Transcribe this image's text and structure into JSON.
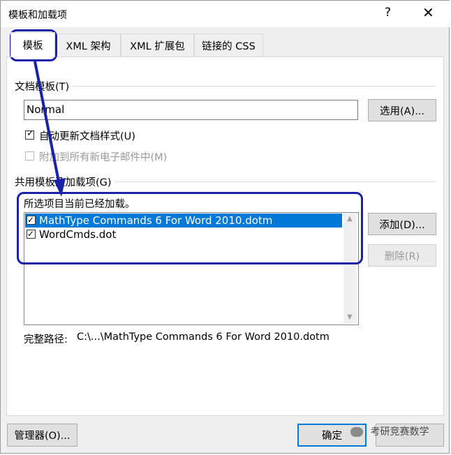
{
  "window": {
    "title": "模板和加载项",
    "help": "?",
    "close": "✕"
  },
  "tabs": [
    {
      "label": "模板",
      "active": true
    },
    {
      "label": "XML 架构"
    },
    {
      "label": "XML 扩展包"
    },
    {
      "label": "链接的 CSS"
    }
  ],
  "document_template": {
    "group_label": "文档模板(T)",
    "value": "Normal",
    "select_button": "选用(A)...",
    "auto_update": {
      "label": "自动更新文档样式(U)",
      "checked": true
    },
    "attach_email": {
      "label": "附加到所有新电子邮件中(M)",
      "checked": false,
      "disabled": true
    }
  },
  "global_templates": {
    "group_label": "共用模板及加载项(G)",
    "hint": "所选项目当前已经加载。",
    "items": [
      {
        "label": "MathType Commands 6 For Word 2010.dotm",
        "checked": true,
        "selected": true
      },
      {
        "label": "WordCmds.dot",
        "checked": true,
        "selected": false
      }
    ],
    "add_button": "添加(D)...",
    "remove_button": "删除(R)",
    "fullpath_label": "完整路径:",
    "fullpath_value": "C:\\...\\MathType Commands 6 For Word 2010.dotm"
  },
  "footer": {
    "organizer_button": "管理器(O)...",
    "ok_button": "确定",
    "cancel_button": "取消"
  },
  "watermark": "考研竞赛数学",
  "colors": {
    "accent": "#0078d7",
    "annotation": "#1a22a8"
  }
}
